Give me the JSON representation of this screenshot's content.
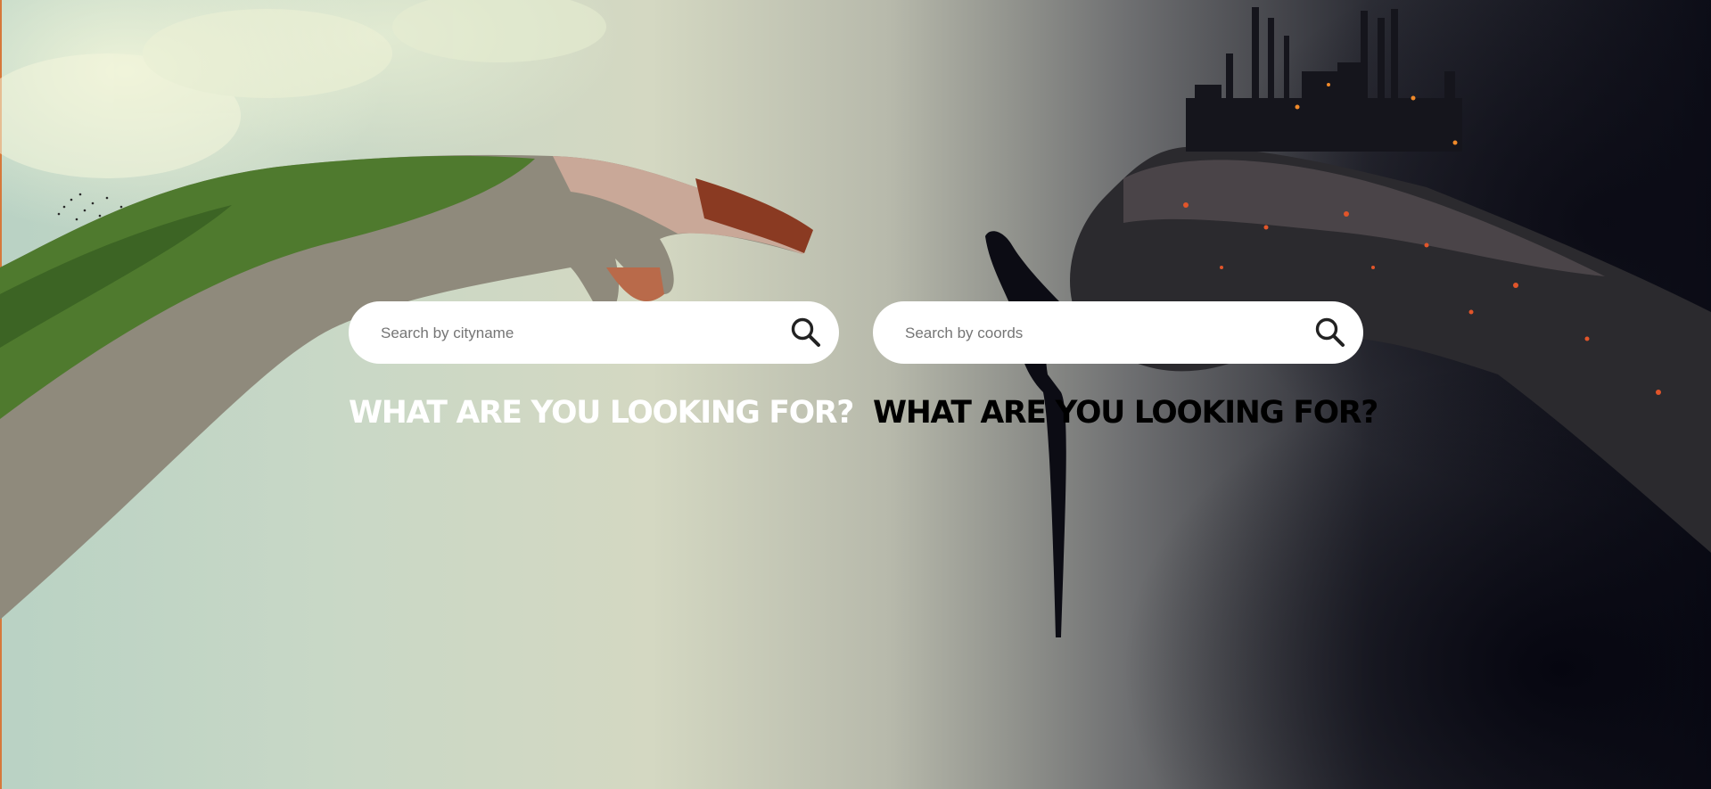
{
  "colors": {
    "headline_left": "#ffffff",
    "headline_right": "#000000",
    "search_bg": "#ffffff",
    "accent_edge": "#d6783a"
  },
  "background": {
    "description_icon": "nature-vs-industry-hands-artwork"
  },
  "search_city": {
    "placeholder": "Search by cityname",
    "value": "",
    "icon": "search-icon"
  },
  "search_coords": {
    "placeholder": "Search by coords",
    "value": "",
    "icon": "search-icon"
  },
  "headline_left": "WHAT ARE YOU LOOKING FOR?",
  "headline_right": "WHAT ARE YOU LOOKING FOR?"
}
